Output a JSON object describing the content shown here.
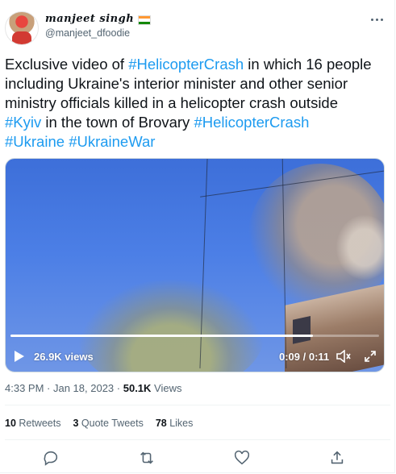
{
  "author": {
    "display_name": "manjeet singh",
    "handle": "@manjeet_dfoodie",
    "flag_icon": "india-flag-icon"
  },
  "tweet": {
    "lines": [
      [
        {
          "text": "Exclusive video of "
        },
        {
          "text": "#HelicopterCrash",
          "tag": true
        },
        {
          "text": " in which 16 people"
        }
      ],
      [
        {
          "text": "including Ukraine's interior minister and other senior"
        }
      ],
      [
        {
          "text": "ministry officials killed in a helicopter crash outside"
        }
      ],
      [
        {
          "text": "#Kyiv",
          "tag": true
        },
        {
          "text": " in the town of Brovary "
        },
        {
          "text": "#HelicopterCrash",
          "tag": true
        }
      ],
      [
        {
          "text": "#Ukraine",
          "tag": true
        },
        {
          "text": " "
        },
        {
          "text": "#UkraineWar",
          "tag": true
        }
      ]
    ]
  },
  "video": {
    "views": "26.9K views",
    "time": "0:09 / 0:11",
    "progress": 0.82
  },
  "meta": {
    "time": "4:33 PM",
    "separator": " · ",
    "date": "Jan 18, 2023",
    "views_count": "50.1K",
    "views_label": " Views"
  },
  "stats": {
    "retweets_count": "10",
    "retweets_label": " Retweets",
    "quotes_count": "3",
    "quotes_label": " Quote Tweets",
    "likes_count": "78",
    "likes_label": " Likes"
  },
  "actions": [
    "reply-icon",
    "retweet-icon",
    "like-icon",
    "share-icon"
  ],
  "colors": {
    "accent": "#1d9bf0",
    "text": "#0f1419",
    "secondary": "#536471"
  }
}
